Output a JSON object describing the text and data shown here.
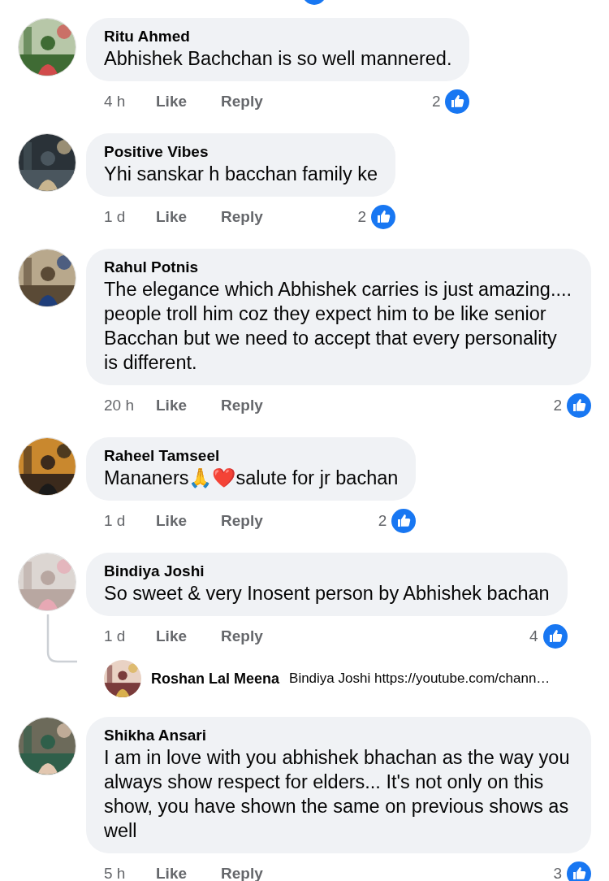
{
  "comments": [
    {
      "author": "Ritu Ahmed",
      "text": "Abhishek Bachchan is so well mannered.",
      "time": "4 h",
      "like": "Like",
      "reply": "Reply",
      "reactions": "2"
    },
    {
      "author": "Positive Vibes",
      "text": "Yhi sanskar h bacchan family ke",
      "time": "1 d",
      "like": "Like",
      "reply": "Reply",
      "reactions": "2"
    },
    {
      "author": "Rahul Potnis",
      "text": "The elegance which Abhishek carries is just amazing.... people troll him coz they expect him to be like senior Bacchan but we need to accept that every personality is different.",
      "time": "20 h",
      "like": "Like",
      "reply": "Reply",
      "reactions": "2"
    },
    {
      "author": "Raheel Tamseel",
      "text": "Mananers🙏❤️salute for jr bachan",
      "time": "1 d",
      "like": "Like",
      "reply": "Reply",
      "reactions": "2"
    },
    {
      "author": "Bindiya Joshi",
      "text": "So sweet & very Inosent person by Abhishek bachan",
      "time": "1 d",
      "like": "Like",
      "reply": "Reply",
      "reactions": "4",
      "replies": [
        {
          "author": "Roshan Lal Meena",
          "text": "Bindiya Joshi https://youtube.com/chann…"
        }
      ]
    },
    {
      "author": "Shikha Ansari",
      "text": "I am in love with you abhishek bhachan as the way you always show respect for elders... It's not only on this show, you have shown the same on previous shows as well",
      "time": "5 h",
      "like": "Like",
      "reply": "Reply",
      "reactions": "3"
    }
  ]
}
